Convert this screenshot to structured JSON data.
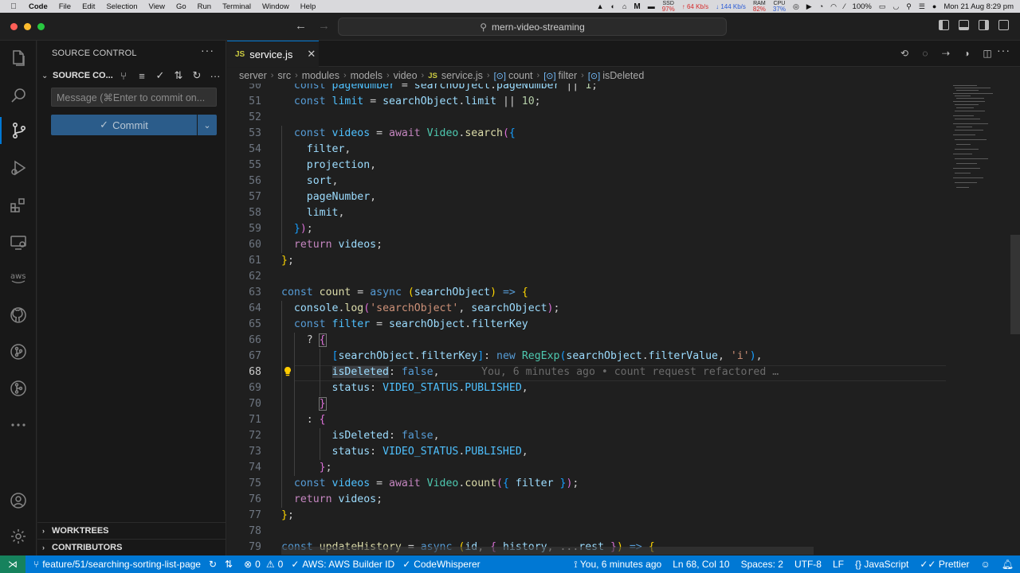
{
  "menubar": {
    "app": "Code",
    "items": [
      "File",
      "Edit",
      "Selection",
      "View",
      "Go",
      "Run",
      "Terminal",
      "Window",
      "Help"
    ],
    "ssd": {
      "label": "SSD",
      "value": "97%"
    },
    "net_up": "↑ 64 Kb/s",
    "net_down": "↓ 144 Kb/s",
    "ram": {
      "label": "RAM",
      "value": "82%"
    },
    "cpu": {
      "label": "CPU",
      "value": "37%"
    },
    "battery": "100%",
    "datetime": "Mon 21 Aug  8:29 pm"
  },
  "titlebar": {
    "search_text": "mern-video-streaming"
  },
  "sidebar": {
    "title": "SOURCE CONTROL",
    "section": "SOURCE CO...",
    "commit_placeholder": "Message (⌘Enter to commit on...",
    "commit_label": "Commit",
    "worktrees": "WORKTREES",
    "contributors": "CONTRIBUTORS"
  },
  "tab": {
    "badge": "JS",
    "name": "service.js"
  },
  "breadcrumb": {
    "parts": [
      "server",
      "src",
      "modules",
      "models",
      "video"
    ],
    "file": "service.js",
    "symbols": [
      "count",
      "filter",
      "isDeleted"
    ]
  },
  "editor": {
    "line_numbers": [
      "50",
      "51",
      "52",
      "53",
      "54",
      "55",
      "56",
      "57",
      "58",
      "59",
      "60",
      "61",
      "62",
      "63",
      "64",
      "65",
      "66",
      "67",
      "68",
      "69",
      "70",
      "71",
      "72",
      "73",
      "74",
      "75",
      "76",
      "77",
      "78",
      "79"
    ],
    "current_line": "68",
    "blame": "You, 6 minutes ago • count request refactored …"
  },
  "statusbar": {
    "branch": "feature/51/searching-sorting-list-page",
    "errors": "0",
    "warnings": "0",
    "aws": "AWS: AWS Builder ID",
    "codewhisperer": "CodeWhisperer",
    "blame": "You, 6 minutes ago",
    "position": "Ln 68, Col 10",
    "spaces": "Spaces: 2",
    "encoding": "UTF-8",
    "eol": "LF",
    "language": "JavaScript",
    "formatter": "Prettier"
  },
  "colors": {
    "accent": "#0078d4",
    "remote": "#16825d",
    "editor_bg": "#1f1f1f"
  }
}
